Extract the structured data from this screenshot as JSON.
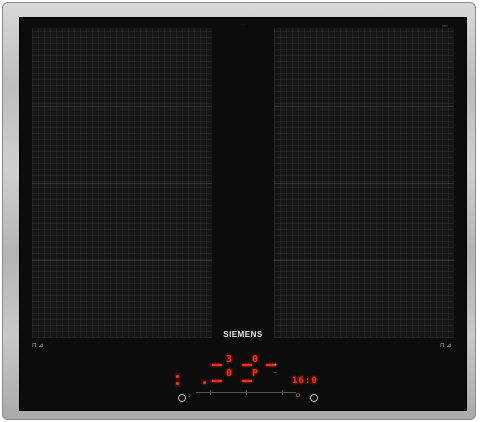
{
  "brand": {
    "name": "SIEMENS"
  },
  "zones": {
    "left_marker": "⊓ ⊿",
    "right_marker": "⊓ ⊿"
  },
  "controls": {
    "front_left_level": "3",
    "front_right_level": "0",
    "rear_left_level": "0",
    "rear_right_level": "P",
    "timer": "16:0",
    "plus_label": "+",
    "minus_label": "−",
    "power_label": "⏻",
    "lock_label": "⌕"
  },
  "colors": {
    "indicator": "#ff2a1a",
    "glass": "#0c0c0c",
    "frame": "#c4c4c4"
  },
  "icons": {
    "power": "power-icon",
    "lock": "lock-icon",
    "timer": "timer-icon"
  }
}
